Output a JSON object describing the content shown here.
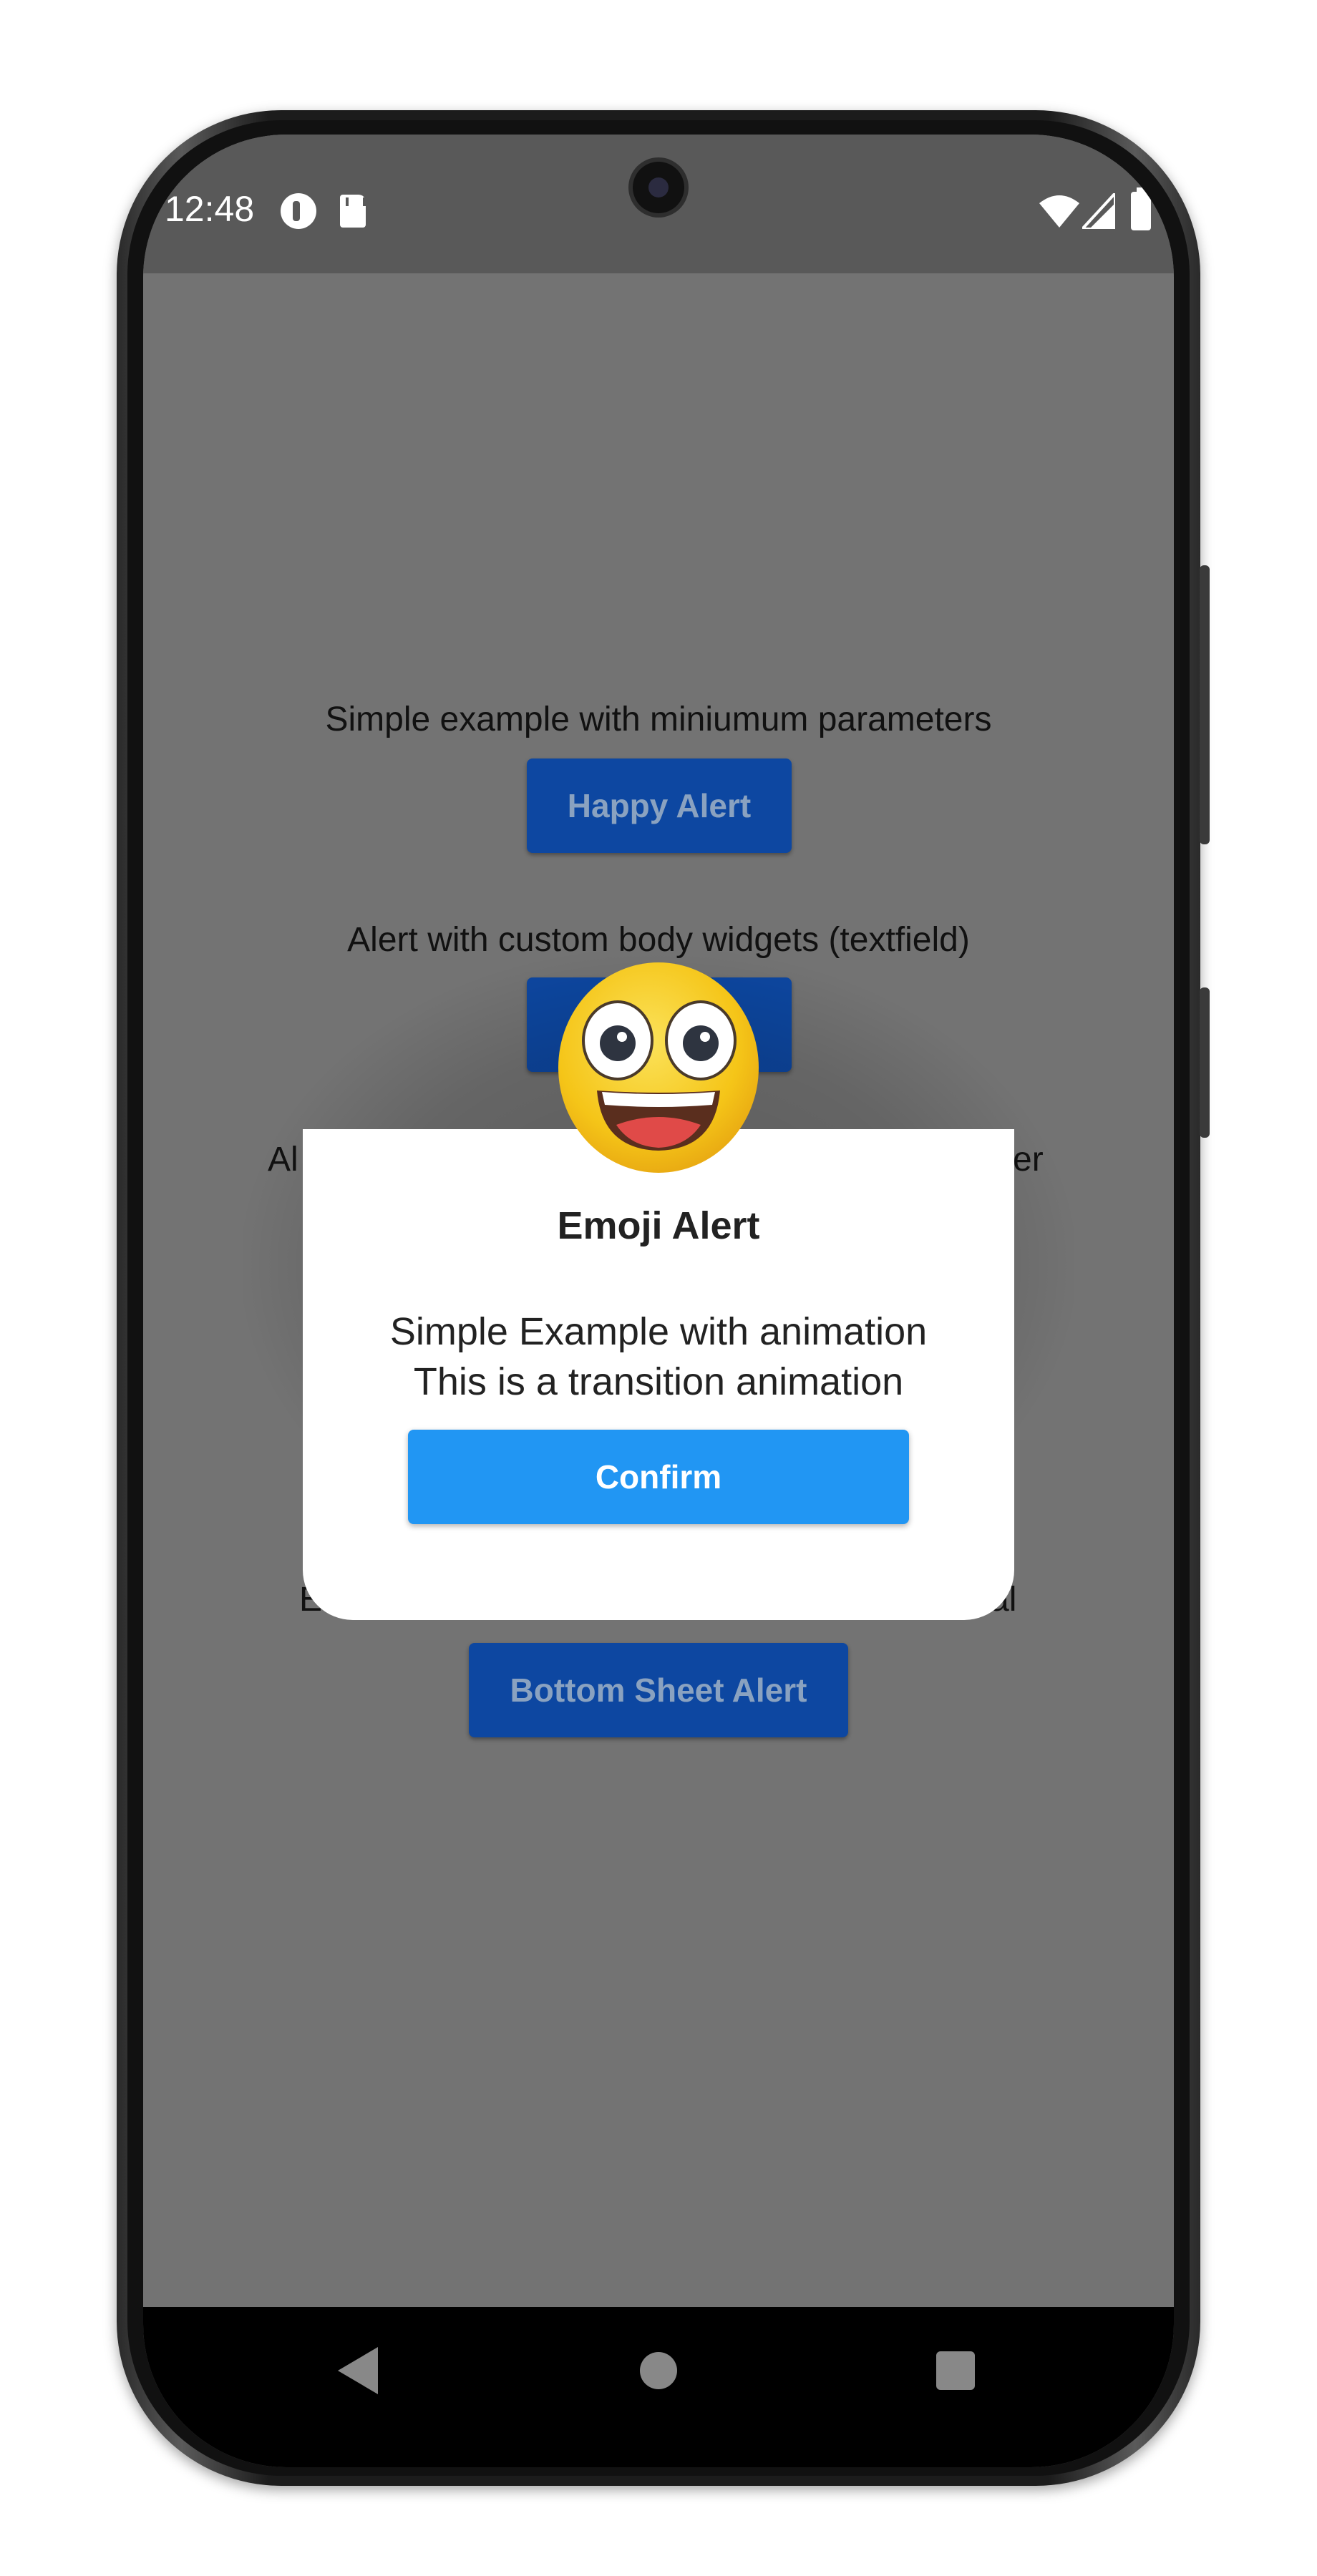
{
  "status_bar": {
    "time": "12:48",
    "icons": [
      "app-notification-icon",
      "sd-card-icon",
      "wifi-icon",
      "signal-icon",
      "battery-icon"
    ]
  },
  "screen": {
    "sections": [
      {
        "label": "Simple example with miniumum parameters",
        "button": "Happy Alert"
      },
      {
        "label": "Alert with custom body widgets (textfield)"
      },
      {
        "label_left": "Al",
        "label_right": "er"
      },
      {
        "label_left": "E",
        "label_right": "al",
        "button": "Bottom Sheet Alert"
      }
    ]
  },
  "dialog": {
    "emoji": "grinning-face-icon",
    "title": "Emoji Alert",
    "body_line1": "Simple Example with animation",
    "body_line2": "This is a transition animation",
    "confirm_label": "Confirm"
  },
  "nav": {
    "icons": [
      "back-icon",
      "home-icon",
      "recent-apps-icon"
    ]
  },
  "colors": {
    "primary_button": "#2196f3",
    "dimmed_button": "#0d47a1",
    "overlay": "#737373",
    "emoji_face": "#f5c518"
  }
}
